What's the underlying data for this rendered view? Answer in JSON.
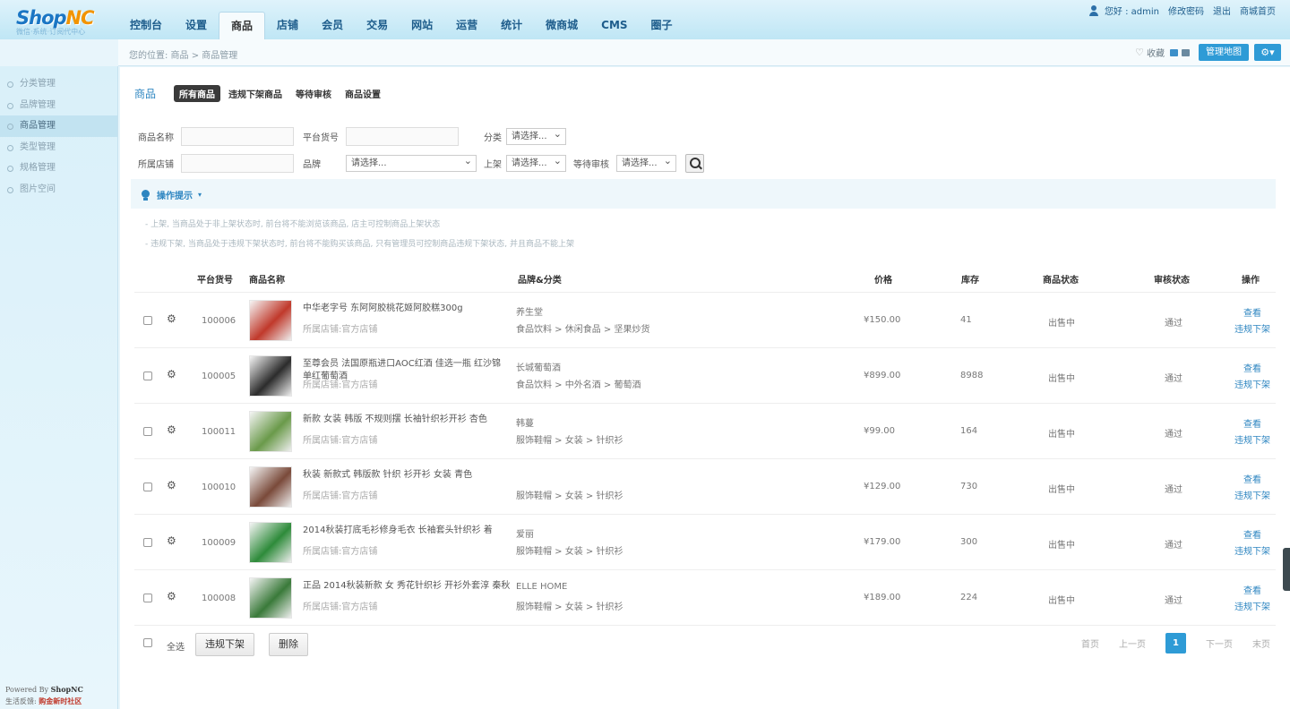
{
  "brand": {
    "name_part1": "Shop",
    "name_part2": "NC",
    "subtitle": "微信·系统·订阅代中心"
  },
  "nav": [
    "控制台",
    "设置",
    "商品",
    "店铺",
    "会员",
    "交易",
    "网站",
    "运营",
    "统计",
    "微商城",
    "CMS",
    "圈子"
  ],
  "nav_active": "商品",
  "user": {
    "greeting": "您好 : admin",
    "change_password": "修改密码",
    "logout": "退出",
    "home": "商城首页"
  },
  "breadcrumb": "您的位置: 商品 > 商品管理",
  "crumb_right": {
    "favorites": "收藏",
    "manage_map": "管理地图"
  },
  "sidebar": [
    "分类管理",
    "品牌管理",
    "商品管理",
    "类型管理",
    "规格管理",
    "图片空间"
  ],
  "sidebar_active": "商品管理",
  "sidebar_footer": {
    "line1_prefix": "Powered By ",
    "line1_brand": "ShopNC",
    "line2_prefix": "生活反馈: ",
    "line2_brand": "购金新时社区"
  },
  "page": {
    "title": "商品",
    "tabs": [
      "所有商品",
      "违规下架商品",
      "等待审核",
      "商品设置"
    ],
    "active_tab": "所有商品"
  },
  "filters": {
    "goods_name": "商品名称",
    "sku": "平台货号",
    "category": "分类",
    "store": "所属店铺",
    "brand": "品牌",
    "shelf": "上架",
    "audit": "等待审核",
    "select_placeholder": "请选择...",
    "select_placeholder_long": "请选择..."
  },
  "tips": {
    "title": "操作提示",
    "line1": "上架, 当商品处于非上架状态时, 前台将不能浏览该商品, 店主可控制商品上架状态",
    "line2": "违规下架, 当商品处于违规下架状态时, 前台将不能购买该商品, 只有管理员可控制商品违规下架状态, 并且商品不能上架"
  },
  "table": {
    "headers": [
      "平台货号",
      "商品名称",
      "品牌&分类",
      "价格",
      "库存",
      "商品状态",
      "审核状态",
      "操作"
    ],
    "rows": [
      {
        "sku": "100006",
        "name": "中华老字号 东阿阿胶桃花姬阿胶糕300g",
        "store": "所属店铺:官方店铺",
        "brand": "养生堂",
        "category": "食品饮料 > 休闲食品 > 坚果炒货",
        "price": "¥150.00",
        "stock": "41",
        "status": "出售中",
        "audit": "通过",
        "view": "查看",
        "offline": "违规下架",
        "thumb_color": "#c0392b"
      },
      {
        "sku": "100005",
        "name": "至尊会员 法国原瓶进口AOC红酒 佳选一瓶 红沙锦 单红葡萄酒",
        "store": "所属店铺:官方店铺",
        "brand": "长城葡萄酒",
        "category": "食品饮料 > 中外名酒 > 葡萄酒",
        "price": "¥899.00",
        "stock": "8988",
        "status": "出售中",
        "audit": "通过",
        "view": "查看",
        "offline": "违规下架",
        "thumb_color": "#2c2c2c"
      },
      {
        "sku": "100011",
        "name": "新款 女装 韩版 不规则摆 长袖针织衫开衫 杏色",
        "store": "所属店铺:官方店铺",
        "brand": "韩蔓",
        "category": "服饰鞋帽 > 女装 > 针织衫",
        "price": "¥99.00",
        "stock": "164",
        "status": "出售中",
        "audit": "通过",
        "view": "查看",
        "offline": "违规下架",
        "thumb_color": "#6a9a4a"
      },
      {
        "sku": "100010",
        "name": "秋装 新款式 韩版款 针织 衫开衫 女装 青色",
        "store": "所属店铺:官方店铺",
        "brand": "",
        "category": "服饰鞋帽 > 女装 > 针织衫",
        "price": "¥129.00",
        "stock": "730",
        "status": "出售中",
        "audit": "通过",
        "view": "查看",
        "offline": "违规下架",
        "thumb_color": "#7a4a3a"
      },
      {
        "sku": "100009",
        "name": "2014秋装打底毛衫修身毛衣 长袖套头针织衫 着",
        "store": "所属店铺:官方店铺",
        "brand": "爱丽",
        "category": "服饰鞋帽 > 女装 > 针织衫",
        "price": "¥179.00",
        "stock": "300",
        "status": "出售中",
        "audit": "通过",
        "view": "查看",
        "offline": "违规下架",
        "thumb_color": "#2e8b3a"
      },
      {
        "sku": "100008",
        "name": "正品 2014秋装新款 女 秀花针织衫 开衫外套淳 秦秋",
        "store": "所属店铺:官方店铺",
        "brand": "ELLE HOME",
        "category": "服饰鞋帽 > 女装 > 针织衫",
        "price": "¥189.00",
        "stock": "224",
        "status": "出售中",
        "audit": "通过",
        "view": "查看",
        "offline": "违规下架",
        "thumb_color": "#3a7a3a"
      }
    ]
  },
  "bulk": {
    "select_all": "全选",
    "offline": "违规下架",
    "delete": "删除"
  },
  "pager": {
    "first": "首页",
    "prev": "上一页",
    "current": "1",
    "next": "下一页",
    "last": "末页"
  }
}
